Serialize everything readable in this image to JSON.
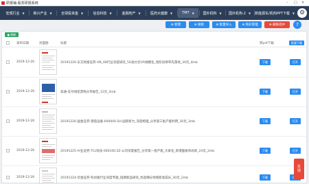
{
  "window": {
    "title": "研报铺-股票研报系统",
    "min": "–",
    "max": "□",
    "close": "✕"
  },
  "nav": {
    "tabs": [
      {
        "label": "宏观行业",
        "arrow": "▼"
      },
      {
        "label": "新兴产业",
        "arrow": "▼"
      },
      {
        "label": "全球投资金",
        "arrow": "▼"
      },
      {
        "label": "信息科技",
        "arrow": "▼"
      },
      {
        "label": "金融地产",
        "arrow": "▼"
      },
      {
        "label": "医药大健康",
        "arrow": "▼"
      },
      {
        "label": "TMT",
        "arrow": "▼"
      },
      {
        "label": "国外机构",
        "arrow": "▼"
      },
      {
        "label": "国外机构-2",
        "arrow": "▼"
      },
      {
        "label": "新能源车/机构PPT下载",
        "arrow": "▼"
      }
    ],
    "settings_icon": "gear-icon"
  },
  "toolbar": {
    "buttons": [
      {
        "label": "⊕ 新建",
        "color": "#2b8cf0"
      },
      {
        "label": "⊕ 搜索",
        "color": "#2b8cf0"
      },
      {
        "label": "⊕ 批量导入",
        "color": "#2b8cf0"
      },
      {
        "label": "⊕ 购买管理",
        "color": "#2b8cf0"
      },
      {
        "label": "⊗ 删除选中",
        "color": "#e64a3b"
      }
    ],
    "help_label": "?"
  },
  "table": {
    "refresh_label": "● 刷新",
    "headers": {
      "date": "发布日期",
      "cover": "封面图",
      "title": "标题",
      "pdf": "转pdf下载",
      "bulk": "批量下载"
    },
    "rows": [
      {
        "date": "2019-12-26",
        "title": "20191226-东方财富证券-VN_A8行业深度研究_5G助力云VR规模化_现阶段将率先落地_30页_4mb",
        "download": "下载",
        "open": "打开",
        "thumb_accent": "#d0312d"
      },
      {
        "date": "2019-12-26",
        "title": "高通-支付线变游戏分享报告_12页_3mb",
        "download": "下载",
        "open": "打开",
        "thumb_accent": "#2b5fa8"
      },
      {
        "date": "2019-12-26",
        "title": "20191226-国金证券-锂电设备-600000.SH-国际新力_深度梳理_分享第三批产能利用_30页_3mb",
        "download": "下载",
        "open": "打开",
        "thumb_accent": "#b8b8b8"
      },
      {
        "date": "2019-12-26",
        "title": "20191225-兴业证券-TCL科技-000100.SZ-公司深度报告_分享第一批产能_大屏化_新增面板布局新_24页_2mb",
        "download": "下载",
        "open": "打开",
        "thumb_accent": "#d0312d"
      },
      {
        "date": "2019-12-26",
        "title": "20191224-华金证券-科创板行业深度专题_短期新品研究_优选细分领域新高成长_30页_2mb",
        "download": "下载",
        "open": "打开",
        "thumb_accent": "#c8c8c8"
      }
    ]
  },
  "float_button": {
    "line1": "反",
    "line2": "馈"
  }
}
